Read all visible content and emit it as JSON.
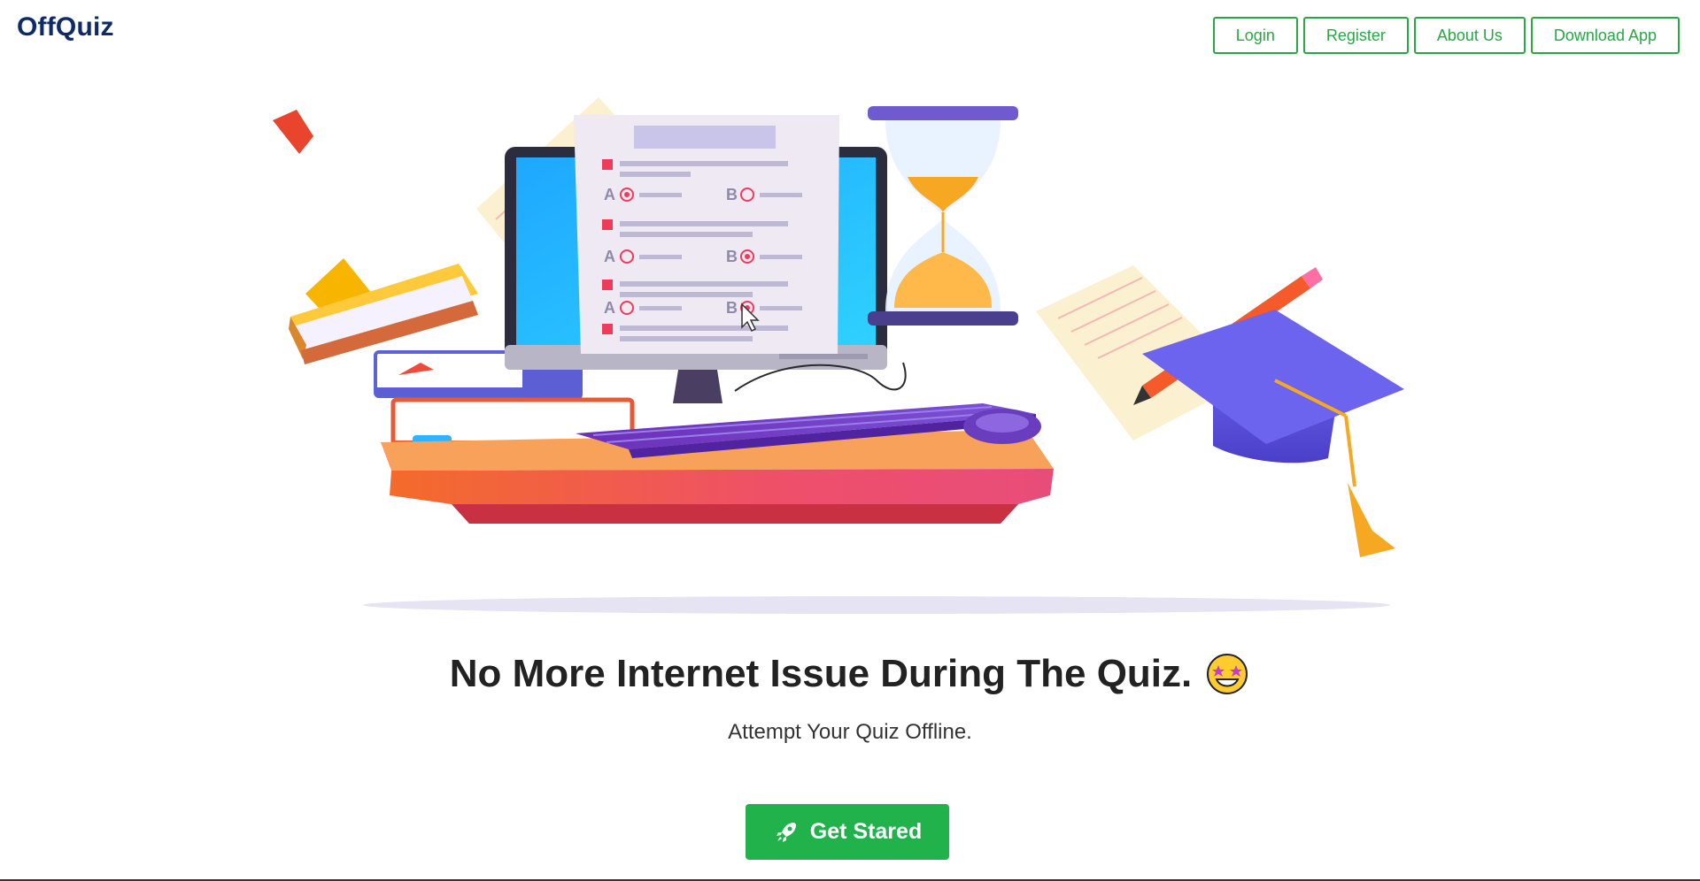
{
  "header": {
    "brand": "OffQuiz",
    "nav": {
      "login": "Login",
      "register": "Register",
      "about": "About Us",
      "download": "Download App"
    }
  },
  "hero": {
    "headline": "No More Internet Issue During The Quiz.",
    "subheadline": "Attempt Your Quiz Offline.",
    "cta_label": "Get Stared",
    "quiz_option_letters": [
      "A",
      "B",
      "A",
      "B",
      "A",
      "B"
    ]
  },
  "colors": {
    "brand": "#0f2a68",
    "accent_green": "#28a745",
    "cta_green": "#22b24c"
  },
  "icons": {
    "cta": "rocket-icon",
    "headline_emoji": "star-struck-emoji-icon"
  }
}
